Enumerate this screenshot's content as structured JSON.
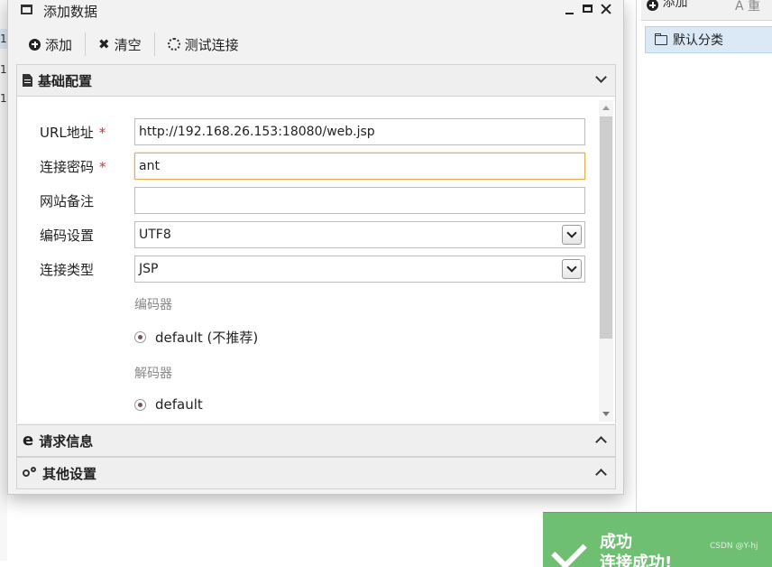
{
  "background": {
    "row_marks": [
      "1",
      "1",
      "1"
    ],
    "right_toolbar": {
      "add_label": "添加",
      "other_label": "A 重"
    },
    "category_item": "默认分类"
  },
  "dialog": {
    "title": "添加数据",
    "toolbar": {
      "add_label": "添加",
      "clear_label": "清空",
      "test_label": "测试连接"
    },
    "sections": {
      "basic": "基础配置",
      "request": "请求信息",
      "other": "其他设置"
    },
    "form": {
      "url_label": "URL地址",
      "url_value": "http://192.168.26.153:18080/web.jsp",
      "password_label": "连接密码",
      "password_value": "ant",
      "note_label": "网站备注",
      "note_value": "",
      "encoding_label": "编码设置",
      "encoding_value": "UTF8",
      "type_label": "连接类型",
      "type_value": "JSP",
      "encoder_title": "编码器",
      "encoder_option": "default (不推荐)",
      "decoder_title": "解码器",
      "decoder_option": "default",
      "required_mark": "*"
    }
  },
  "toast": {
    "title": "成功",
    "message": "连接成功!"
  },
  "watermark": "CSDN @Y-hj",
  "colors": {
    "toast_bg": "#6fbf73",
    "required": "#e02b2b",
    "focus_border": "#e0b15a",
    "selection": "#dbe9f6"
  }
}
